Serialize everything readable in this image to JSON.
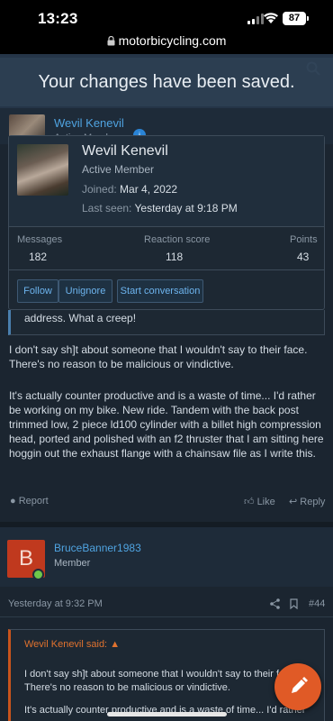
{
  "status": {
    "time": "13:23",
    "battery": "87"
  },
  "browser": {
    "url": "motorbicycling.com"
  },
  "toast": {
    "message": "Your changes have been saved."
  },
  "post1": {
    "author": "Wevil Kenevil",
    "author_title": "Active Member"
  },
  "member_card": {
    "name": "Wevil Kenevil",
    "title": "Active Member",
    "joined_label": "Joined:",
    "joined_value": "Mar 4, 2022",
    "last_seen_label": "Last seen:",
    "last_seen_value": "Yesterday at 9:18 PM",
    "stats": {
      "messages_label": "Messages",
      "messages_value": "182",
      "reaction_label": "Reaction score",
      "reaction_value": "118",
      "points_label": "Points",
      "points_value": "43"
    },
    "buttons": {
      "follow": "Follow",
      "unignore": "Unignore",
      "start_conversation": "Start conversation"
    }
  },
  "post1_body": {
    "quote_tail": "address. What a creep!",
    "para1": "I don't say sh]t about someone that I wouldn't say to their face. There's no reason to be malicious or vindictive.",
    "para2": "It's actually counter productive and is a waste of time... I'd rather be working on my bike. New ride. Tandem with the back post trimmed low, 2 piece ld100 cylinder with a billet high compression head, ported and polished with an f2 thruster that I am sitting here hoggin out the exhaust flange with a chainsaw file as I write this."
  },
  "post1_actions": {
    "report": "Report",
    "like": "Like",
    "reply": "Reply"
  },
  "post2": {
    "avatar_letter": "B",
    "author": "BruceBanner1983",
    "author_title": "Member",
    "time": "Yesterday at 9:32 PM",
    "number": "#44",
    "quote_header": "Wevil Kenevil said:",
    "quote_para1": "I don't say sh]t about someone that I wouldn't say to their face. There's no reason to be malicious or vindictive.",
    "quote_para2": "It's actually counter productive and is a waste of time... I'd rather"
  },
  "colors": {
    "accent": "#4fa3e0",
    "fab": "#e05a26",
    "avatar_b": "#c0391e"
  }
}
